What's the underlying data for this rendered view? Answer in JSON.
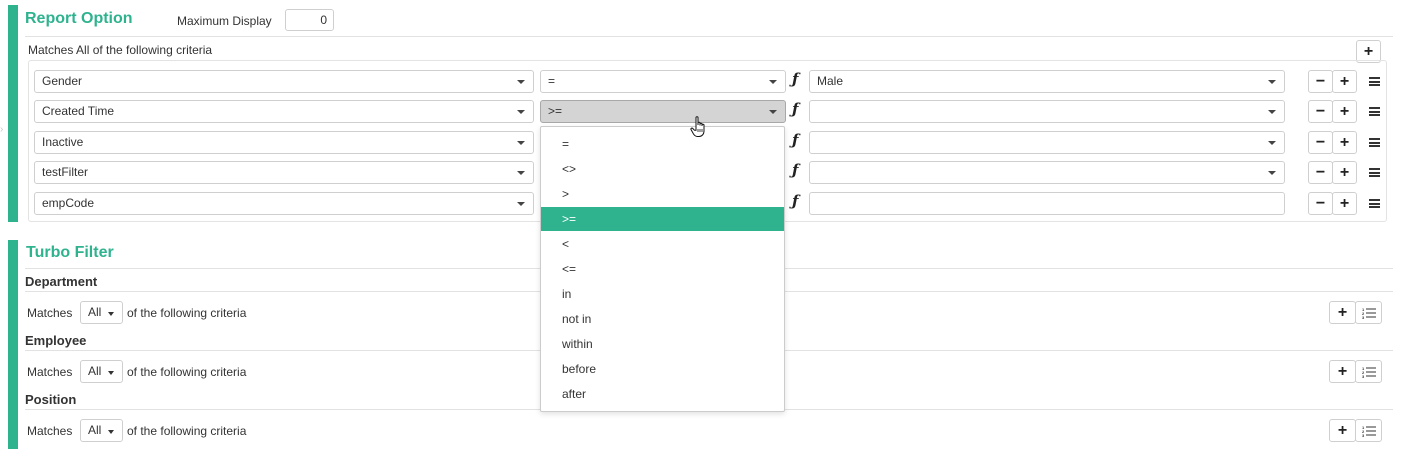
{
  "report_option": {
    "title": "Report Option",
    "max_display_label": "Maximum Display",
    "max_display_value": "0",
    "matches_text": "Matches All of the following criteria",
    "rows": [
      {
        "field": "Gender",
        "operator": "=",
        "value": "Male",
        "value_is_select": true
      },
      {
        "field": "Created Time",
        "operator": ">=",
        "value": "",
        "value_is_select": true
      },
      {
        "field": "Inactive",
        "operator": "",
        "value": "",
        "value_is_select": true
      },
      {
        "field": "testFilter",
        "operator": "",
        "value": "",
        "value_is_select": true
      },
      {
        "field": "empCode",
        "operator": "",
        "value": "",
        "value_is_select": false
      }
    ],
    "function_glyph": "ƒ",
    "operator_dropdown": {
      "options": [
        "=",
        "<>",
        ">",
        ">=",
        "<",
        "<=",
        "in",
        "not in",
        "within",
        "before",
        "after"
      ],
      "selected": ">="
    }
  },
  "turbo_filter": {
    "title": "Turbo Filter",
    "groups": [
      {
        "name": "Department",
        "matches": "Matches",
        "mode": "All",
        "suffix": "of the following criteria"
      },
      {
        "name": "Employee",
        "matches": "Matches",
        "mode": "All",
        "suffix": "of the following criteria"
      },
      {
        "name": "Position",
        "matches": "Matches",
        "mode": "All",
        "suffix": "of the following criteria"
      }
    ]
  },
  "icons": {
    "add": "plus-icon",
    "remove": "minus-icon",
    "drag": "drag-handle-icon",
    "function": "function-icon",
    "ordered_list": "ordered-list-icon",
    "cursor": "hand-pointer-cursor"
  },
  "colors": {
    "accent": "#2fb38f",
    "border": "#cfcfcf",
    "active_select": "#d4d4d4"
  }
}
